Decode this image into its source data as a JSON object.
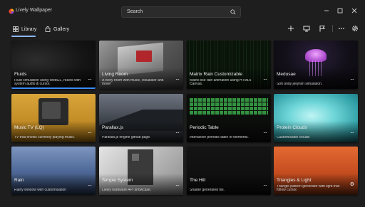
{
  "app": {
    "title": "Lively Wallpaper"
  },
  "search": {
    "placeholder": "Search"
  },
  "nav": {
    "library": "Library",
    "gallery": "Gallery"
  },
  "icons": {
    "logo": "lively-logo-icon",
    "search": "search-icon",
    "minimize": "minimize-icon",
    "maximize": "maximize-icon",
    "close": "close-icon",
    "library": "grid-icon",
    "gallery": "shopping-bag-icon",
    "add": "plus-icon",
    "screen": "monitor-icon",
    "pause": "flag-icon",
    "more": "more-icon",
    "settings": "gear-icon"
  },
  "colors": {
    "accent": "#3b8dfa",
    "background": "#1e1e1e"
  },
  "wallpapers": [
    {
      "title": "Fluids",
      "desc": "Fluid simulation using WebGL, reacts with system audio & cursor.",
      "action": "···",
      "selected": true
    },
    {
      "title": "Living Room",
      "desc": "A lively room with music, visualizer and more!",
      "action": "···"
    },
    {
      "title": "Matrix Rain Customizable",
      "desc": "Matrix like rain animation using HTML5 Canvas.",
      "action": "···"
    },
    {
      "title": "Medusae",
      "desc": "Soft body jellyfish simulation.",
      "action": "···"
    },
    {
      "title": "Music TV (LQ)",
      "desc": "TV that shows currently playing music.",
      "action": "···"
    },
    {
      "title": "Parallax.js",
      "desc": "Parallax.js engine github page.",
      "action": "···"
    },
    {
      "title": "Periodic Table",
      "desc": "Interactive periodic table of elements.",
      "action": "···"
    },
    {
      "title": "Protein Clouds",
      "desc": "Customisable clouds",
      "action": "···"
    },
    {
      "title": "Rain",
      "desc": "Rainy window with customisation",
      "action": "···"
    },
    {
      "title": "Simple System",
      "desc": "Lively hardware API showcase.",
      "action": "···"
    },
    {
      "title": "The Hill",
      "desc": "Shader generated hill.",
      "action": "···"
    },
    {
      "title": "Triangles & Light",
      "desc": "Triangle pattern generator with light that follow cursor.",
      "action": "⚙"
    }
  ]
}
